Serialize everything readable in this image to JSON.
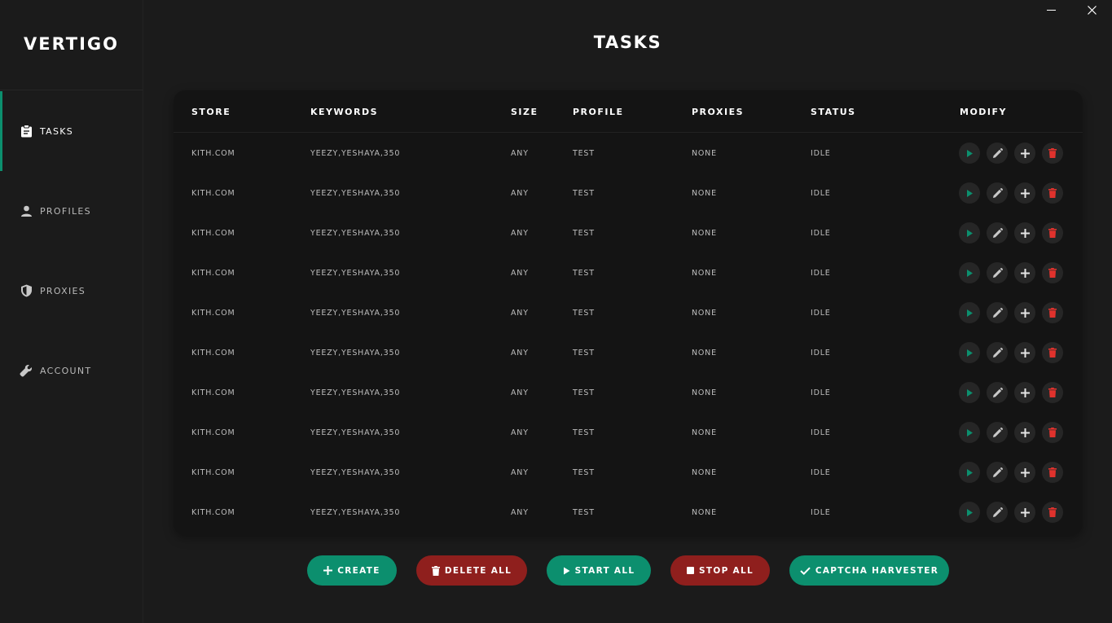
{
  "app": {
    "brand": "VERTIGO"
  },
  "page": {
    "title": "TASKS"
  },
  "sidebar": {
    "items": [
      {
        "label": "TASKS",
        "icon": "clipboard-icon",
        "active": true
      },
      {
        "label": "PROFILES",
        "icon": "person-icon",
        "active": false
      },
      {
        "label": "PROXIES",
        "icon": "shield-icon",
        "active": false
      },
      {
        "label": "ACCOUNT",
        "icon": "wrench-icon",
        "active": false
      }
    ]
  },
  "table": {
    "headers": [
      "STORE",
      "KEYWORDS",
      "SIZE",
      "PROFILE",
      "PROXIES",
      "STATUS",
      "MODIFY"
    ],
    "rows": [
      {
        "store": "KITH.COM",
        "keywords": "YEEZY,YESHAYA,350",
        "size": "ANY",
        "profile": "TEST",
        "proxies": "NONE",
        "status": "IDLE"
      },
      {
        "store": "KITH.COM",
        "keywords": "YEEZY,YESHAYA,350",
        "size": "ANY",
        "profile": "TEST",
        "proxies": "NONE",
        "status": "IDLE"
      },
      {
        "store": "KITH.COM",
        "keywords": "YEEZY,YESHAYA,350",
        "size": "ANY",
        "profile": "TEST",
        "proxies": "NONE",
        "status": "IDLE"
      },
      {
        "store": "KITH.COM",
        "keywords": "YEEZY,YESHAYA,350",
        "size": "ANY",
        "profile": "TEST",
        "proxies": "NONE",
        "status": "IDLE"
      },
      {
        "store": "KITH.COM",
        "keywords": "YEEZY,YESHAYA,350",
        "size": "ANY",
        "profile": "TEST",
        "proxies": "NONE",
        "status": "IDLE"
      },
      {
        "store": "KITH.COM",
        "keywords": "YEEZY,YESHAYA,350",
        "size": "ANY",
        "profile": "TEST",
        "proxies": "NONE",
        "status": "IDLE"
      },
      {
        "store": "KITH.COM",
        "keywords": "YEEZY,YESHAYA,350",
        "size": "ANY",
        "profile": "TEST",
        "proxies": "NONE",
        "status": "IDLE"
      },
      {
        "store": "KITH.COM",
        "keywords": "YEEZY,YESHAYA,350",
        "size": "ANY",
        "profile": "TEST",
        "proxies": "NONE",
        "status": "IDLE"
      },
      {
        "store": "KITH.COM",
        "keywords": "YEEZY,YESHAYA,350",
        "size": "ANY",
        "profile": "TEST",
        "proxies": "NONE",
        "status": "IDLE"
      },
      {
        "store": "KITH.COM",
        "keywords": "YEEZY,YESHAYA,350",
        "size": "ANY",
        "profile": "TEST",
        "proxies": "NONE",
        "status": "IDLE"
      }
    ],
    "row_actions": [
      "play-icon",
      "pencil-icon",
      "plus-icon",
      "trash-icon"
    ]
  },
  "buttons": {
    "create": "CREATE",
    "delete_all": "DELETE ALL",
    "start_all": "START ALL",
    "stop_all": "STOP ALL",
    "captcha": "CAPTCHA HARVESTER"
  },
  "colors": {
    "accent_green": "#0c8f6e",
    "danger_red": "#8f1f1d",
    "trash_icon_red": "#e0322d",
    "background": "#1b1b1b",
    "card": "#141414"
  }
}
